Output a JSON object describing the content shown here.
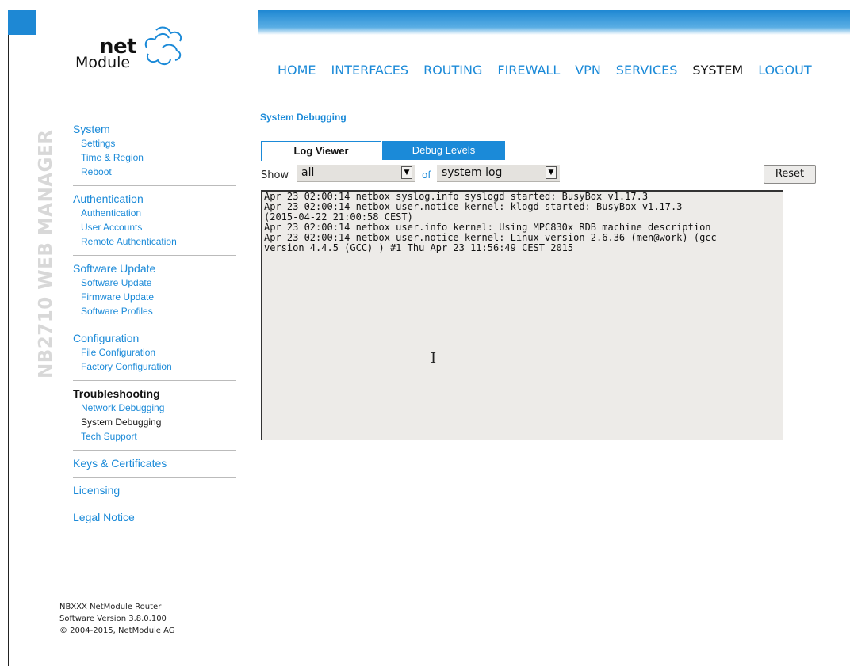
{
  "header": {
    "logo_net": "net",
    "logo_module": "Module",
    "nav": [
      "HOME",
      "INTERFACES",
      "ROUTING",
      "FIREWALL",
      "VPN",
      "SERVICES",
      "SYSTEM",
      "LOGOUT"
    ],
    "active_nav": "SYSTEM",
    "accent_color": "#1b8ad8"
  },
  "vertical_title": "NB2710 WEB MANAGER",
  "sidebar": {
    "groups": [
      {
        "title": "System",
        "items": [
          "Settings",
          "Time & Region",
          "Reboot"
        ]
      },
      {
        "title": "Authentication",
        "items": [
          "Authentication",
          "User Accounts",
          "Remote Authentication"
        ]
      },
      {
        "title": "Software Update",
        "items": [
          "Software Update",
          "Firmware Update",
          "Software Profiles"
        ]
      },
      {
        "title": "Configuration",
        "items": [
          "File Configuration",
          "Factory Configuration"
        ]
      },
      {
        "title": "Troubleshooting",
        "items": [
          "Network Debugging",
          "System Debugging",
          "Tech Support"
        ]
      },
      {
        "title": "Keys & Certificates",
        "items": []
      },
      {
        "title": "Licensing",
        "items": []
      },
      {
        "title": "Legal Notice",
        "items": []
      }
    ],
    "active_group": "Troubleshooting",
    "active_item": "System Debugging"
  },
  "footer": {
    "line1": "NBXXX NetModule Router",
    "line2": "Software Version 3.8.0.100",
    "line3": "© 2004-2015, NetModule AG"
  },
  "main": {
    "title": "System Debugging",
    "tabs": [
      "Log Viewer",
      "Debug Levels"
    ],
    "active_tab": "Log Viewer",
    "show_label": "Show",
    "show_value": "all",
    "of_label": "of",
    "of_value": "system log",
    "reset_label": "Reset",
    "log_lines": [
      "Apr 23 02:00:14 netbox syslog.info syslogd started: BusyBox v1.17.3",
      "Apr 23 02:00:14 netbox user.notice kernel: klogd started: BusyBox v1.17.3",
      "(2015-04-22 21:00:58 CEST)",
      "Apr 23 02:00:14 netbox user.info kernel: Using MPC830x RDB machine description",
      "Apr 23 02:00:14 netbox user.notice kernel: Linux version 2.6.36 (men@work) (gcc",
      "version 4.4.5 (GCC) ) #1 Thu Apr 23 11:56:49 CEST 2015"
    ]
  }
}
